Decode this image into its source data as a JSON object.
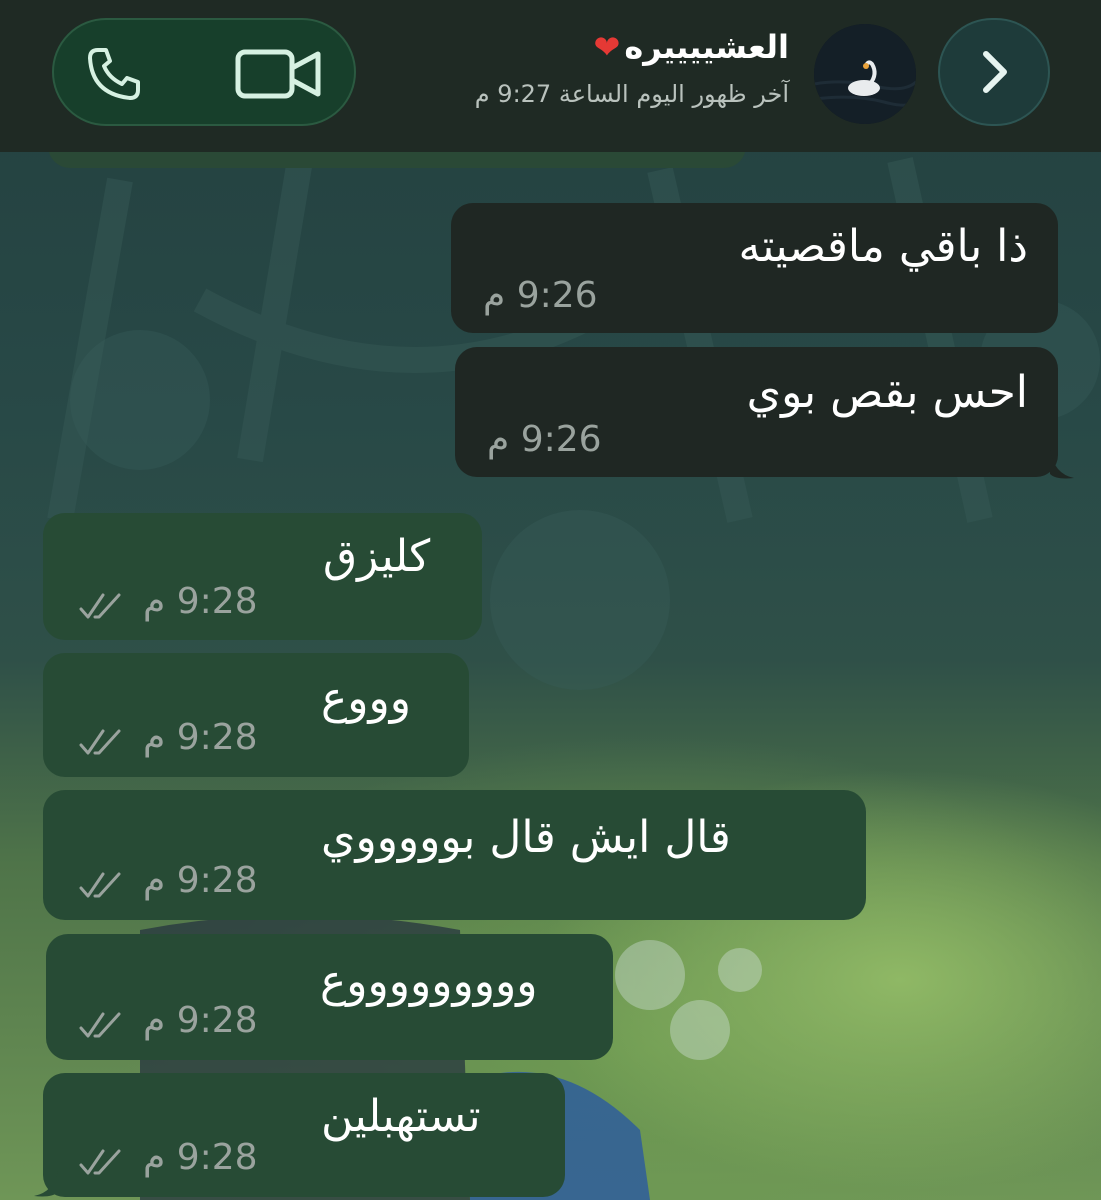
{
  "header": {
    "contact_name": "العشييييره",
    "last_seen": "آخر ظهور اليوم الساعة 9:27 م"
  },
  "icons": [
    "phone-icon",
    "video-call-icon",
    "chevron-right-icon",
    "swan-avatar-icon",
    "double-check-icon"
  ],
  "messages": [
    {
      "direction": "incoming",
      "text": "ذا باقي ماقصيته",
      "time": "9:26 م"
    },
    {
      "direction": "incoming",
      "text": "احس بقص بوي",
      "time": "9:26 م"
    },
    {
      "direction": "outgoing",
      "text": "كليزق",
      "time": "9:28 م",
      "read": true
    },
    {
      "direction": "outgoing",
      "text": "وووع",
      "time": "9:28 م",
      "read": true
    },
    {
      "direction": "outgoing",
      "text": "قال ايش قال بوووووي",
      "time": "9:28 م",
      "read": true
    },
    {
      "direction": "outgoing",
      "text": "وووووووووع",
      "time": "9:28 م",
      "read": true
    },
    {
      "direction": "outgoing",
      "text": "تستهبلين",
      "time": "9:28 م",
      "read": true
    }
  ],
  "colors": {
    "header_bg": "#1f2a24",
    "incoming_bubble": "#1f2723",
    "outgoing_bubble": "#274b35",
    "heart": "#e53935",
    "read_ticks": "#9aa39e"
  }
}
